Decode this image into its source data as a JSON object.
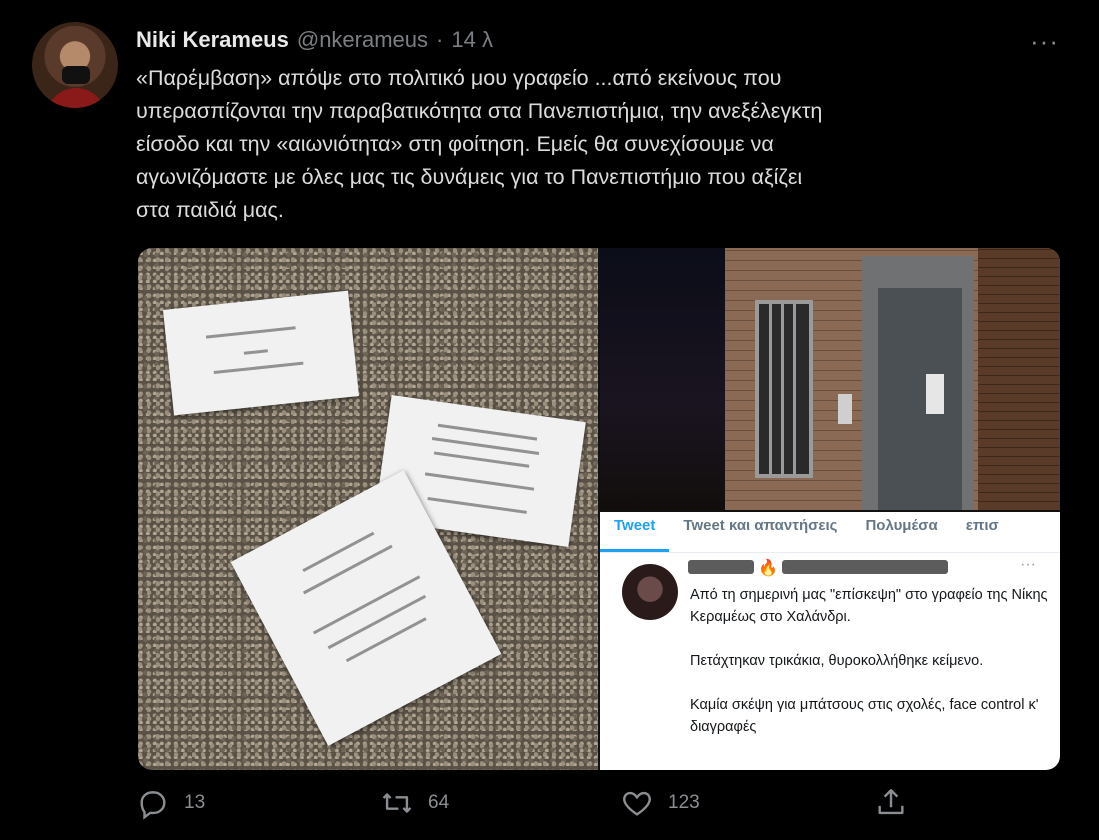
{
  "author": {
    "name": "Niki Kerameus",
    "handle": "@nkerameus",
    "separator": "·",
    "time": "14 λ"
  },
  "more_label": "···",
  "tweet_text": [
    "«Παρέμβαση» απόψε στο πολιτικό μου γραφείο ...από εκείνους που",
    "υπερασπίζονται την παραβατικότητα στα Πανεπιστήμια, την ανεξέλεγκτη",
    "είσοδο και την «αιωνιότητα» στη φοίτηση. Εμείς θα συνεχίσουμε να",
    "αγωνιζόμαστε με όλες μας τις δυνάμεις για το Πανεπιστήμιο που αξίζει",
    "στα παιδιά μας."
  ],
  "embedded_screenshot": {
    "tabs": [
      "Tweet",
      "Tweet και απαντήσεις",
      "Πολυμέσα",
      "επισ"
    ],
    "active_tab": "Tweet",
    "more_label": "···",
    "paragraphs": [
      "Από τη σημερινή μας \"επίσκεψη\" στο γραφείο της Νίκης Κεραμέως στο Χαλάνδρι.",
      "Πετάχτηκαν τρικάκια, θυροκολλήθηκε κείμενο.",
      "Καμία σκέψη για μπάτσους στις σχολές, face control κ' διαγραφές"
    ]
  },
  "actions": {
    "replies": "13",
    "retweets": "64",
    "likes": "123"
  },
  "icons": [
    "reply-icon",
    "retweet-icon",
    "like-icon",
    "share-icon",
    "more-icon"
  ],
  "colors": {
    "background": "#000000",
    "accent": "#1da1f2",
    "muted": "#8a8d91"
  }
}
